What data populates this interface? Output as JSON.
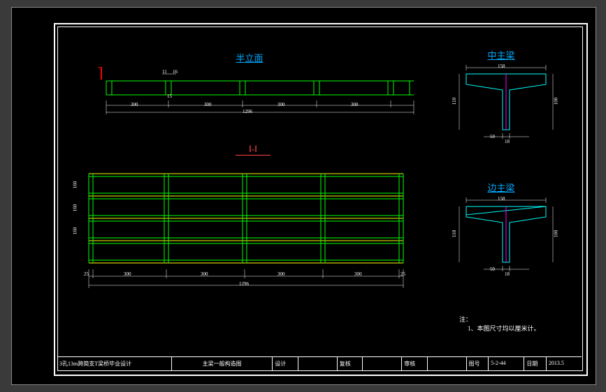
{
  "titles": {
    "elevation": "半立面",
    "section": "Ⅰ-Ⅰ",
    "mid_beam": "中主梁",
    "side_beam": "边主梁"
  },
  "elevation": {
    "dims_top": [
      "11",
      "16"
    ],
    "dim_small": "15",
    "spacing": [
      "300",
      "300",
      "300",
      "300"
    ],
    "total": "1296"
  },
  "plan": {
    "rows": [
      "160",
      "160",
      "160"
    ],
    "edge": "25",
    "spacing": [
      "300",
      "300",
      "300",
      "300"
    ],
    "total": "1296"
  },
  "mid_beam": {
    "top": "158",
    "height": "110",
    "web": "18",
    "bottom": "50",
    "rheight": "100"
  },
  "side_beam": {
    "top": "158",
    "height": "110",
    "web": "18",
    "bottom": "50",
    "rheight": "100"
  },
  "note": {
    "label": "注：",
    "line1": "1、本图尺寸均以厘米计。"
  },
  "titleblock": {
    "project": "3孔13m跨简支T梁桥毕业设计",
    "drawing": "主梁一般构造图",
    "design": "设计",
    "check": "复核",
    "approve": "审核",
    "sheet_label": "图号",
    "sheet": "5-2-44",
    "date_label": "日期",
    "date": "2013.5"
  }
}
